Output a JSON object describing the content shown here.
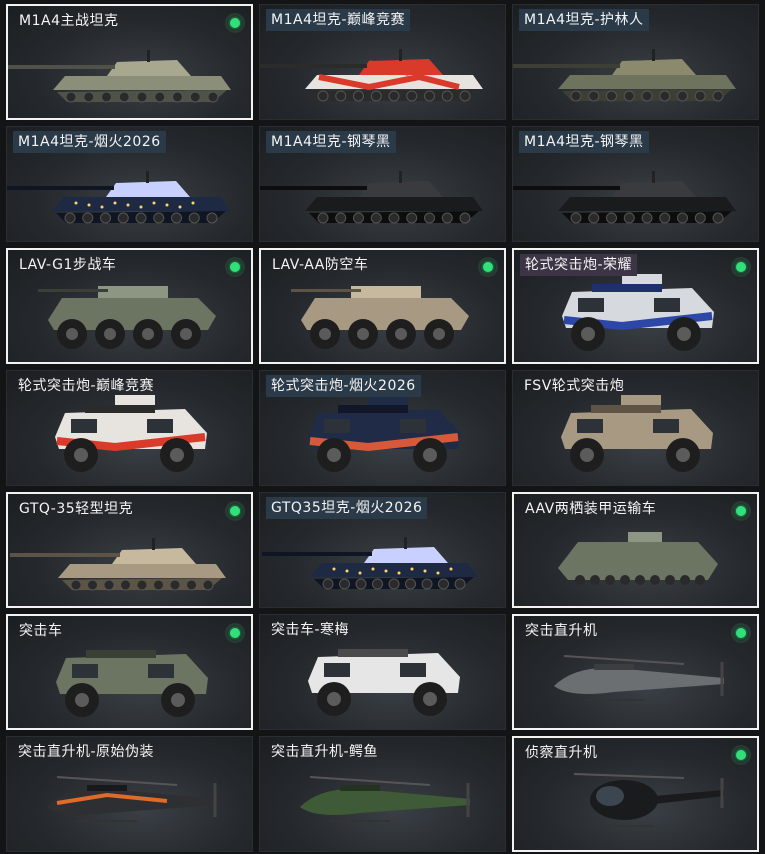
{
  "cards": [
    {
      "id": "c0",
      "label": "M1A4主战坦克",
      "type": "tank",
      "theme": "camo",
      "equipped": true,
      "selected": true
    },
    {
      "id": "c1",
      "label": "M1A4坦克-巅峰竞赛",
      "type": "tank",
      "theme": "red",
      "equipped": false,
      "selected": false
    },
    {
      "id": "c2",
      "label": "M1A4坦克-护林人",
      "type": "tank",
      "theme": "forest",
      "equipped": false,
      "selected": false
    },
    {
      "id": "c3",
      "label": "M1A4坦克-烟火2026",
      "type": "tank",
      "theme": "fire2026",
      "equipped": false,
      "selected": false
    },
    {
      "id": "c4",
      "label": "M1A4坦克-钢琴黑",
      "type": "tank",
      "theme": "black",
      "equipped": false,
      "selected": false
    },
    {
      "id": "c5",
      "label": "M1A4坦克-钢琴黑",
      "type": "tank",
      "theme": "black",
      "equipped": false,
      "selected": false
    },
    {
      "id": "c6",
      "label": "LAV-G1步战车",
      "type": "lav",
      "theme": "green",
      "equipped": true,
      "selected": true
    },
    {
      "id": "c7",
      "label": "LAV-AA防空车",
      "type": "lav",
      "theme": "sand",
      "equipped": true,
      "selected": true
    },
    {
      "id": "c8",
      "label": "轮式突击炮-荣耀",
      "type": "wheeled",
      "theme": "glory",
      "equipped": true,
      "selected": true
    },
    {
      "id": "c9",
      "label": "轮式突击炮-巅峰竞赛",
      "type": "wheeled",
      "theme": "red",
      "equipped": false,
      "selected": false
    },
    {
      "id": "c10",
      "label": "轮式突击炮-烟火2026",
      "type": "wheeled",
      "theme": "fire",
      "equipped": false,
      "selected": false
    },
    {
      "id": "c11",
      "label": "FSV轮式突击炮",
      "type": "wheeled",
      "theme": "sand",
      "equipped": false,
      "selected": false
    },
    {
      "id": "c12",
      "label": "GTQ-35轻型坦克",
      "type": "light",
      "theme": "sand",
      "equipped": true,
      "selected": true
    },
    {
      "id": "c13",
      "label": "GTQ35坦克-烟火2026",
      "type": "light",
      "theme": "fire2026",
      "equipped": false,
      "selected": false
    },
    {
      "id": "c14",
      "label": "AAV两栖装甲运输车",
      "type": "aav",
      "theme": "green",
      "equipped": true,
      "selected": true
    },
    {
      "id": "c15",
      "label": "突击车",
      "type": "mrap",
      "theme": "green",
      "equipped": true,
      "selected": true
    },
    {
      "id": "c16",
      "label": "突击车-寒梅",
      "type": "mrap",
      "theme": "white",
      "equipped": false,
      "selected": false
    },
    {
      "id": "c17",
      "label": "突击直升机",
      "type": "heli",
      "theme": "grey",
      "equipped": true,
      "selected": true
    },
    {
      "id": "c18",
      "label": "突击直升机-原始伪装",
      "type": "heli",
      "theme": "orange",
      "equipped": false,
      "selected": false
    },
    {
      "id": "c19",
      "label": "突击直升机-鳄鱼",
      "type": "heli",
      "theme": "croc",
      "equipped": false,
      "selected": false
    },
    {
      "id": "c20",
      "label": "侦察直升机",
      "type": "scout",
      "theme": "black",
      "equipped": true,
      "selected": true
    }
  ],
  "badge_2026": "2026",
  "colors": {
    "equipped_dot": "#2fe07b",
    "selected_border": "#f2f2f2",
    "card_bg": "#2a2e32"
  }
}
